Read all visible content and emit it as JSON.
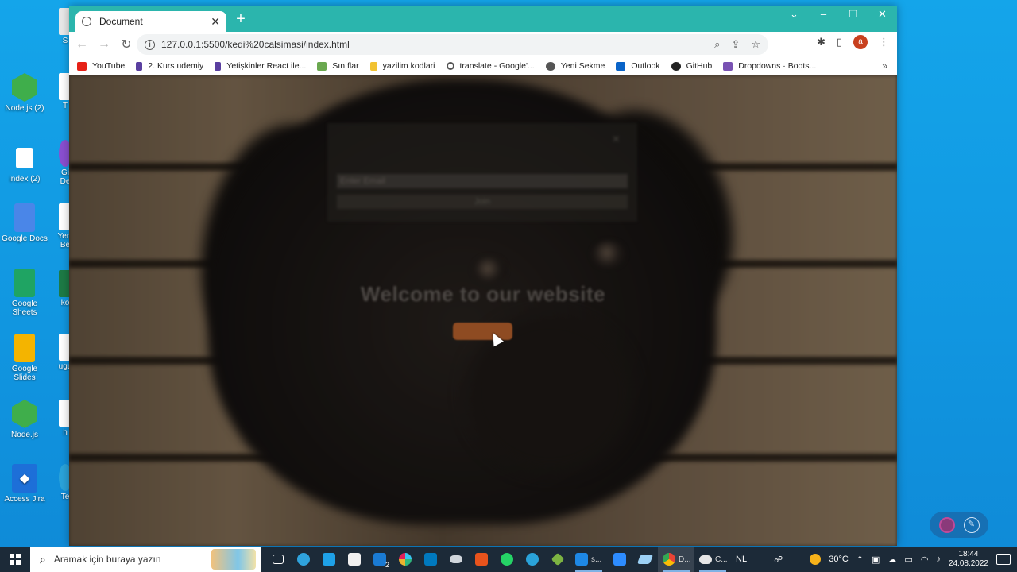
{
  "desktop": {
    "icons_col1": [
      {
        "label": "Node.js (2)",
        "color": "#3fae4b"
      },
      {
        "label": "index (2)",
        "color": "#ffffff"
      },
      {
        "label": "Google Docs",
        "color": "#4a86e8"
      },
      {
        "label": "Google Sheets",
        "color": "#1fa463"
      },
      {
        "label": "Google Slides",
        "color": "#f4b400"
      },
      {
        "label": "Node.js",
        "color": "#3fae4b"
      },
      {
        "label": "Access Jira",
        "color": "#1d6fd8"
      }
    ],
    "icons_col2": [
      "S",
      "T",
      "Gi De",
      "Yeni Be",
      "ko",
      "ugu",
      "h",
      "Te"
    ]
  },
  "browser": {
    "tab_title": "Document",
    "new_tab": "+",
    "url": "127.0.0.1:5500/kedi%20calsimasi/index.html",
    "avatar_letter": "a",
    "bookmarks": [
      {
        "label": "YouTube",
        "color": "#e62117"
      },
      {
        "label": "2. Kurs udemiy",
        "color": "#5a3fa0"
      },
      {
        "label": "Yetişkinler React ile...",
        "color": "#5a3fa0"
      },
      {
        "label": "Sınıflar",
        "color": "#6aa84f"
      },
      {
        "label": "yazilim kodlari",
        "color": "#f1c232"
      },
      {
        "label": "translate - Google'...",
        "color": "#555555"
      },
      {
        "label": "Yeni Sekme",
        "color": "#555555"
      },
      {
        "label": "Outlook",
        "color": "#0a64c8"
      },
      {
        "label": "GitHub",
        "color": "#222222"
      },
      {
        "label": "Dropdowns · Boots...",
        "color": "#7952b3"
      }
    ],
    "bookmarks_more": "»"
  },
  "page": {
    "modal": {
      "close": "×",
      "email_placeholder": "Enter Email",
      "join_label": "Join"
    },
    "welcome": "Welcome to our website",
    "cta_label": ""
  },
  "taskbar": {
    "search_placeholder": "Aramak için buraya yazın",
    "mail_badge": "2",
    "vscode_label": "s...",
    "chrome_label": "D...",
    "cloud_label": "C...",
    "lang": "NL",
    "temperature": "30°C",
    "time": "18:44",
    "date": "24.08.2022"
  }
}
